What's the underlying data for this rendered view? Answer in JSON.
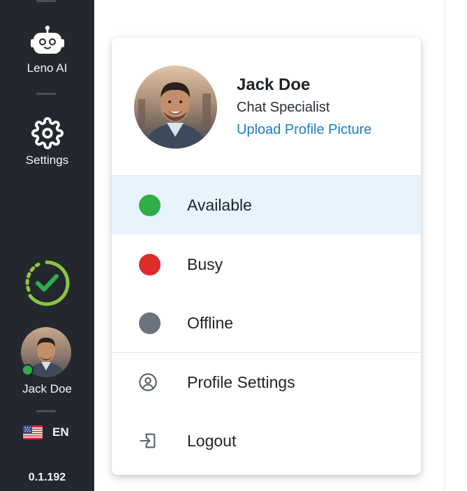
{
  "sidebar": {
    "bot": {
      "label": "Leno AI",
      "icon": "robot-icon"
    },
    "settings": {
      "label": "Settings",
      "icon": "gear-icon"
    },
    "status_ring": {
      "icon": "availability-check-icon",
      "color": "#8cc63f"
    },
    "user": {
      "name": "Jack Doe",
      "status_color": "#2fae4a"
    },
    "language": {
      "code": "EN",
      "flag": "us-flag-icon"
    },
    "version": "0.1.192"
  },
  "profile_menu": {
    "name": "Jack Doe",
    "role": "Chat Specialist",
    "upload_link": "Upload Profile Picture",
    "statuses": [
      {
        "label": "Available",
        "color": "#2fae4a",
        "selected": true
      },
      {
        "label": "Busy",
        "color": "#dc2c2c",
        "selected": false
      },
      {
        "label": "Offline",
        "color": "#6b737c",
        "selected": false
      }
    ],
    "actions": [
      {
        "label": "Profile Settings",
        "icon": "user-circle-icon"
      },
      {
        "label": "Logout",
        "icon": "logout-icon"
      }
    ]
  },
  "colors": {
    "sidebar_bg": "#24282e",
    "accent_link": "#1b7fc4",
    "selected_row_bg": "#e8f3fc"
  }
}
